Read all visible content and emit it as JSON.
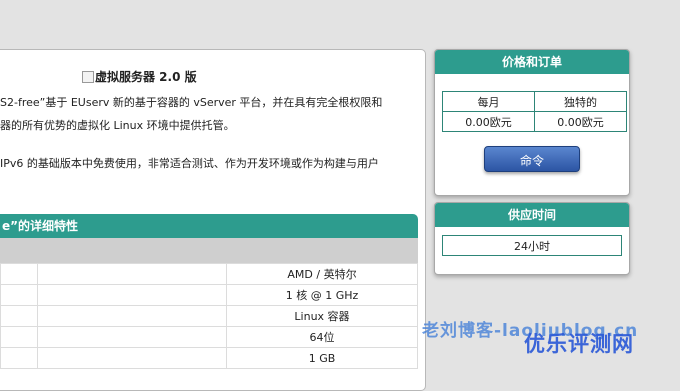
{
  "main": {
    "title": "虚拟服务器 2.0 版",
    "para1_line1": "S2-free”基于 EUserv 新的基于容器的 vServer 平台，并在具有完全根权限和",
    "para1_line2": "器的所有优势的虚拟化 Linux 环境中提供托管。",
    "para2_line1": "IPv6 的基础版本中免费使用，非常适合测试、作为开发环境或作为构建与用户",
    "section_title": "e”的详细特性",
    "specs": [
      "AMD / 英特尔",
      "1 核 @ 1 GHz",
      "Linux 容器",
      "64位",
      "1 GB"
    ]
  },
  "price_box": {
    "title": "价格和订单",
    "headers": [
      "每月",
      "独特的"
    ],
    "values": [
      "0.00欧元",
      "0.00欧元"
    ],
    "order_label": "命令"
  },
  "supply_box": {
    "title": "供应时间",
    "value": "24小时"
  },
  "watermark": {
    "line1": "老刘博客-laoliublog.cn",
    "line2": "优乐评测网"
  }
}
